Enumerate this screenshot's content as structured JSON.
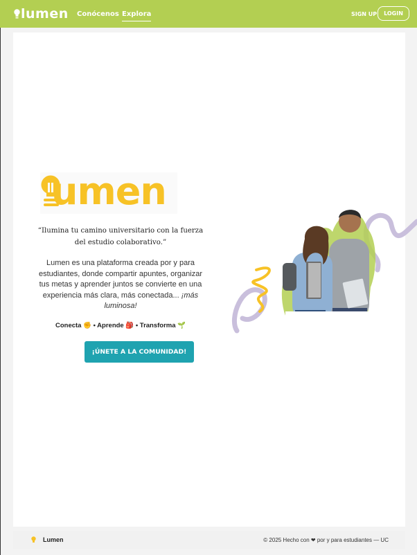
{
  "nav": {
    "logo": "lumen",
    "links": [
      "Conócenos",
      "Explora"
    ],
    "active": "Explora",
    "signup": "SIGN UP",
    "login": "LOGIN"
  },
  "hero": {
    "logo_text": "umen",
    "quote_line1": "“Ilumina tu camino universitario con la fuerza",
    "quote_line2": "del estudio colaborativo.”",
    "desc_main": "Lumen es una plataforma creada por y para estudiantes, donde compartir apuntes, organizar tus metas y aprender juntos se convierte en una experiencia más clara, más conectada... ",
    "desc_em": "¡más luminosa!",
    "tags": "Conecta ✊ • Aprende 🎒 • Transforma 🌱",
    "cta": "¡ÚNETE A LA COMUNIDAD!"
  },
  "footer": {
    "brand": "Lumen",
    "copy": "© 2025 Hecho con ❤ por y para estudiantes — UC"
  },
  "colors": {
    "nav_green": "#b3cf52",
    "brand_yellow": "#f7c226",
    "cta_teal": "#1fa3b0",
    "squiggle_purple": "#c9bfdc"
  }
}
